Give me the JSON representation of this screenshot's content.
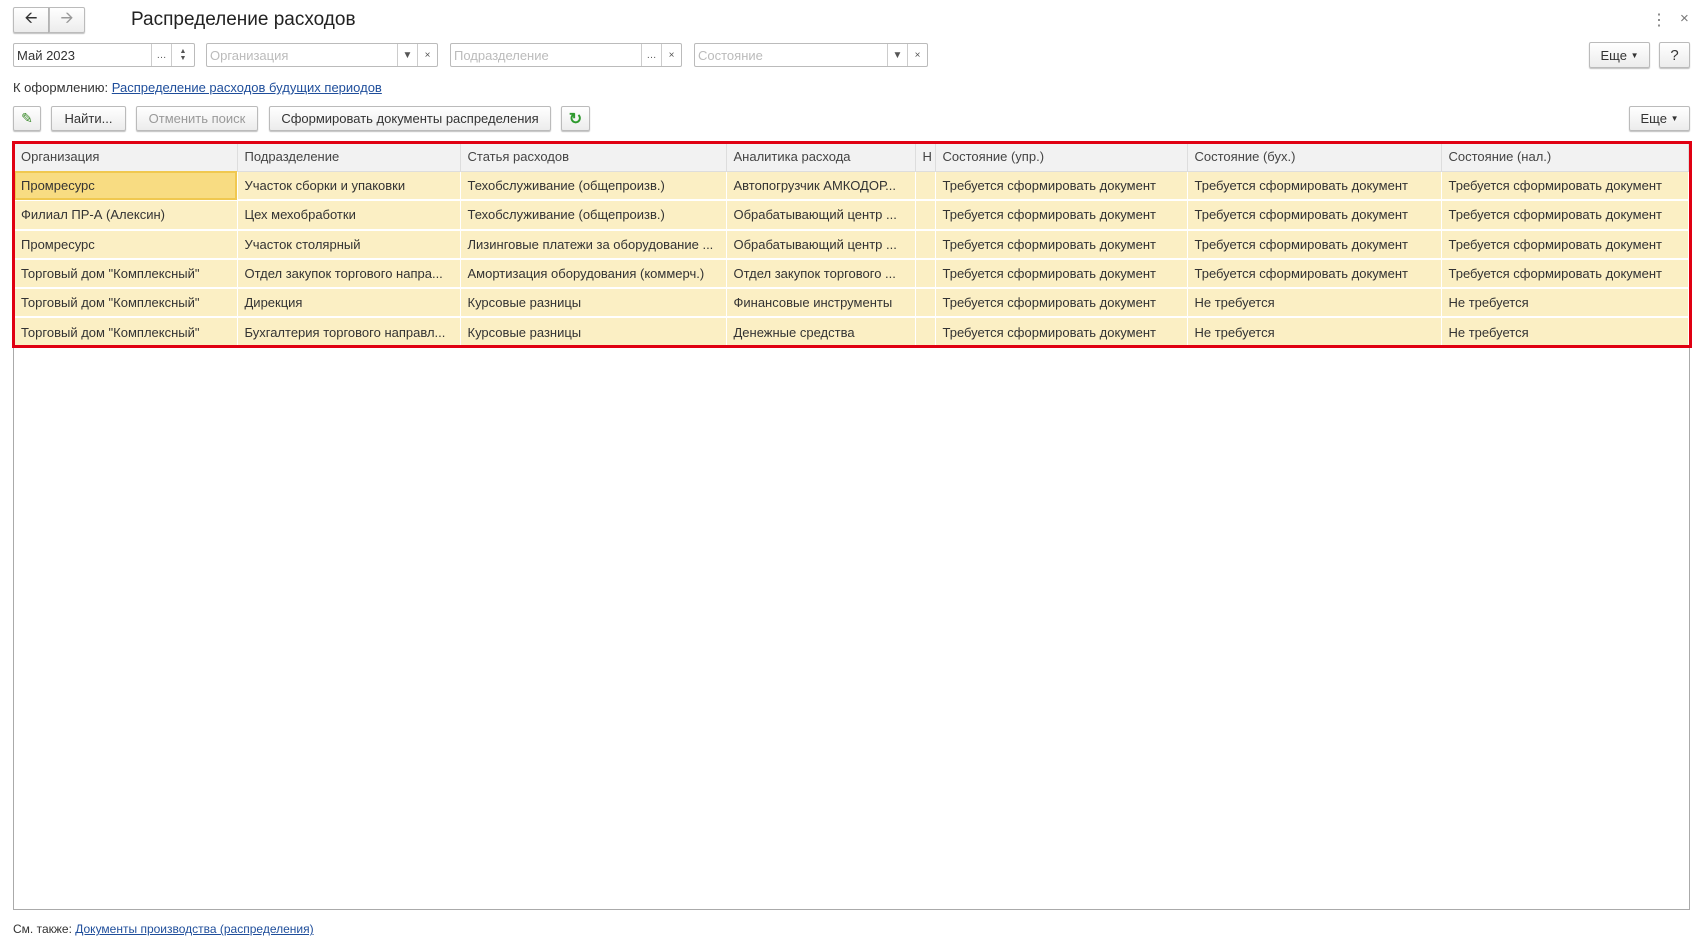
{
  "window": {
    "title": "Распределение расходов",
    "back_icon": "arrow-left",
    "forward_icon": "arrow-right"
  },
  "filters": {
    "period": "Май 2023",
    "organization_placeholder": "Организация",
    "department_placeholder": "Подразделение",
    "state_placeholder": "Состояние",
    "more_label": "Еще",
    "help_label": "?"
  },
  "todo": {
    "label": "К оформлению:",
    "link": "Распределение расходов будущих периодов"
  },
  "toolbar": {
    "find": "Найти...",
    "cancel_search": "Отменить поиск",
    "generate": "Сформировать документы распределения",
    "more": "Еще"
  },
  "table": {
    "columns": [
      "Организация",
      "Подразделение",
      "Статья расходов",
      "Аналитика расхода",
      "Н",
      "Состояние (упр.)",
      "Состояние (бух.)",
      "Состояние (нал.)"
    ],
    "rows": [
      [
        "Промресурс",
        "Участок сборки и упаковки",
        "Техобслуживание (общепроизв.)",
        "Автопогрузчик АМКОДОР...",
        "",
        "Требуется сформировать документ",
        "Требуется сформировать документ",
        "Требуется сформировать документ"
      ],
      [
        "Филиал ПР-А (Алексин)",
        "Цех мехобработки",
        "Техобслуживание (общепроизв.)",
        "Обрабатывающий центр ...",
        "",
        "Требуется сформировать документ",
        "Требуется сформировать документ",
        "Требуется сформировать документ"
      ],
      [
        "Промресурс",
        "Участок столярный",
        "Лизинговые платежи за оборудование ...",
        "Обрабатывающий центр ...",
        "",
        "Требуется сформировать документ",
        "Требуется сформировать документ",
        "Требуется сформировать документ"
      ],
      [
        "Торговый дом \"Комплексный\"",
        "Отдел закупок торгового напра...",
        "Амортизация оборудования (коммерч.)",
        "Отдел закупок торгового ...",
        "",
        "Требуется сформировать документ",
        "Требуется сформировать документ",
        "Требуется сформировать документ"
      ],
      [
        "Торговый дом \"Комплексный\"",
        "Дирекция",
        "Курсовые разницы",
        "Финансовые инструменты",
        "",
        "Требуется сформировать документ",
        "Не требуется",
        "Не требуется"
      ],
      [
        "Торговый дом \"Комплексный\"",
        "Бухгалтерия торгового направл...",
        "Курсовые разницы",
        "Денежные средства",
        "",
        "Требуется сформировать документ",
        "Не требуется",
        "Не требуется"
      ]
    ]
  },
  "footer": {
    "label": "См. также:",
    "link": "Документы производства (распределения)"
  }
}
